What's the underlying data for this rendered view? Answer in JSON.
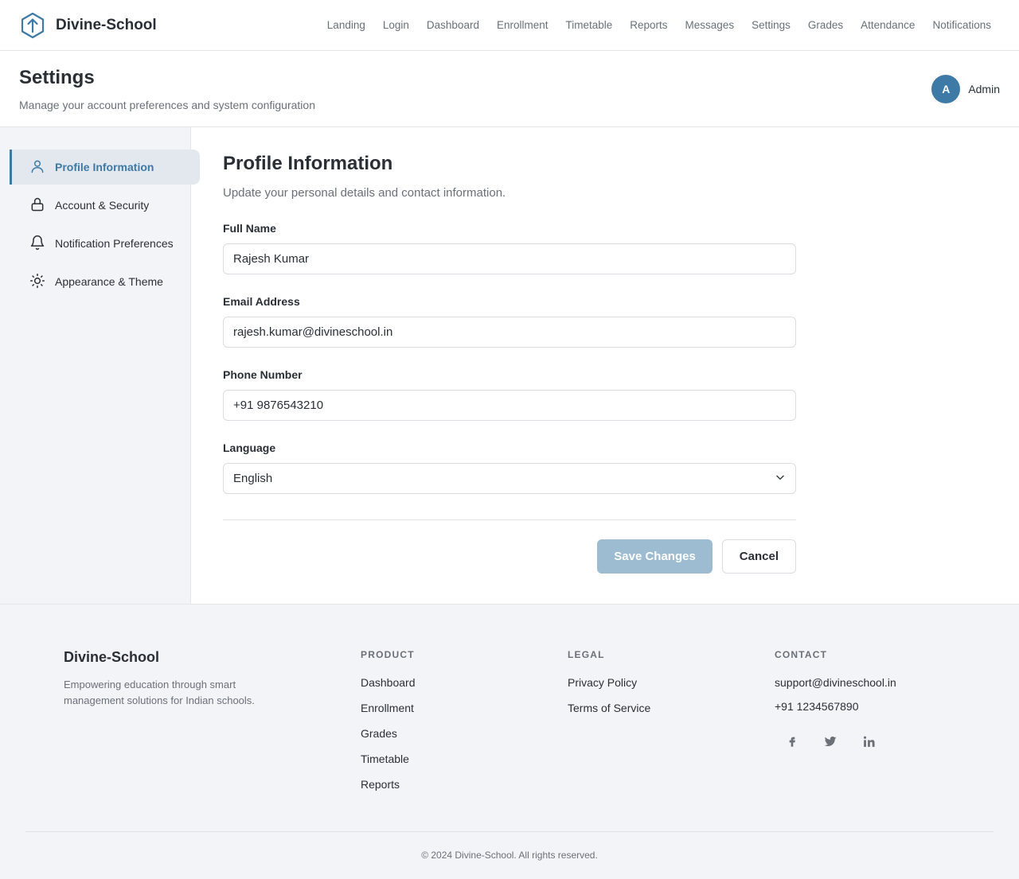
{
  "brand": {
    "name": "Divine-School"
  },
  "nav": {
    "items": [
      "Landing",
      "Login",
      "Dashboard",
      "Enrollment",
      "Timetable",
      "Reports",
      "Messages",
      "Settings",
      "Grades",
      "Attendance",
      "Notifications"
    ]
  },
  "header": {
    "title": "Settings",
    "subtitle": "Manage your account preferences and system configuration",
    "user": {
      "initial": "A",
      "name": "Admin"
    }
  },
  "sidebar": {
    "items": [
      {
        "label": "Profile Information",
        "icon": "user-icon",
        "active": true
      },
      {
        "label": "Account & Security",
        "icon": "lock-icon",
        "active": false
      },
      {
        "label": "Notification Preferences",
        "icon": "bell-icon",
        "active": false
      },
      {
        "label": "Appearance & Theme",
        "icon": "sun-icon",
        "active": false
      }
    ]
  },
  "profile": {
    "title": "Profile Information",
    "description": "Update your personal details and contact information.",
    "full_name": {
      "label": "Full Name",
      "value": "Rajesh Kumar"
    },
    "email": {
      "label": "Email Address",
      "value": "rajesh.kumar@divineschool.in"
    },
    "phone": {
      "label": "Phone Number",
      "value": "+91 9876543210"
    },
    "language": {
      "label": "Language",
      "value": "English"
    },
    "save_label": "Save Changes",
    "cancel_label": "Cancel"
  },
  "footer": {
    "brand_name": "Divine-School",
    "brand_desc": "Empowering education through smart management solutions for Indian schools.",
    "product": {
      "title": "PRODUCT",
      "links": [
        "Dashboard",
        "Enrollment",
        "Grades",
        "Timetable",
        "Reports"
      ]
    },
    "legal": {
      "title": "LEGAL",
      "links": [
        "Privacy Policy",
        "Terms of Service"
      ]
    },
    "contact": {
      "title": "CONTACT",
      "email": "support@divineschool.in",
      "phone": "+91 1234567890"
    },
    "socials": [
      "facebook-icon",
      "twitter-icon",
      "linkedin-icon"
    ],
    "copyright": "© 2024 Divine-School. All rights reserved."
  },
  "colors": {
    "accent": "#3d7aa6",
    "primary_button": "#9dbcd2",
    "sidebar_bg": "#f3f4f8"
  }
}
